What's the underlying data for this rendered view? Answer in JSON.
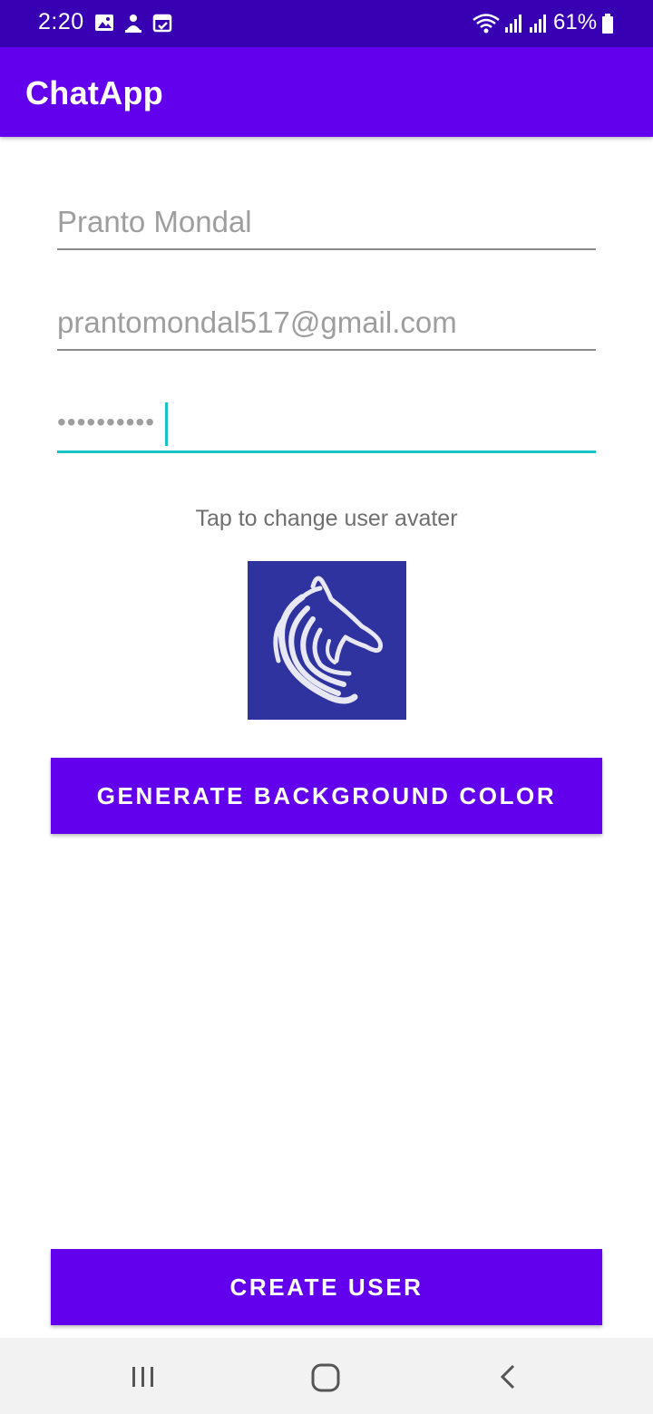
{
  "status_bar": {
    "time": "2:20",
    "battery_percent": "61%",
    "icons": [
      "gallery-icon",
      "android-head-icon",
      "calendar-check-icon",
      "wifi-icon",
      "signal-icon",
      "signal-icon",
      "battery-icon"
    ]
  },
  "app_bar": {
    "title": "ChatApp"
  },
  "form": {
    "name_value": "Pranto Mondal",
    "email_value": "prantomondal517@gmail.com",
    "password_masked": "••••••••••"
  },
  "avatar": {
    "hint": "Tap to change user avater",
    "icon": "horse-head-icon",
    "background_color": "#2f33a0"
  },
  "buttons": {
    "generate_label": "GENERATE BACKGROUND COLOR",
    "create_label": "CREATE USER"
  },
  "nav_bar": {
    "items": [
      "recents-icon",
      "home-icon",
      "back-icon"
    ]
  },
  "colors": {
    "primary": "#6200ee",
    "primary_dark": "#3700b3",
    "accent": "#17c3c3"
  }
}
